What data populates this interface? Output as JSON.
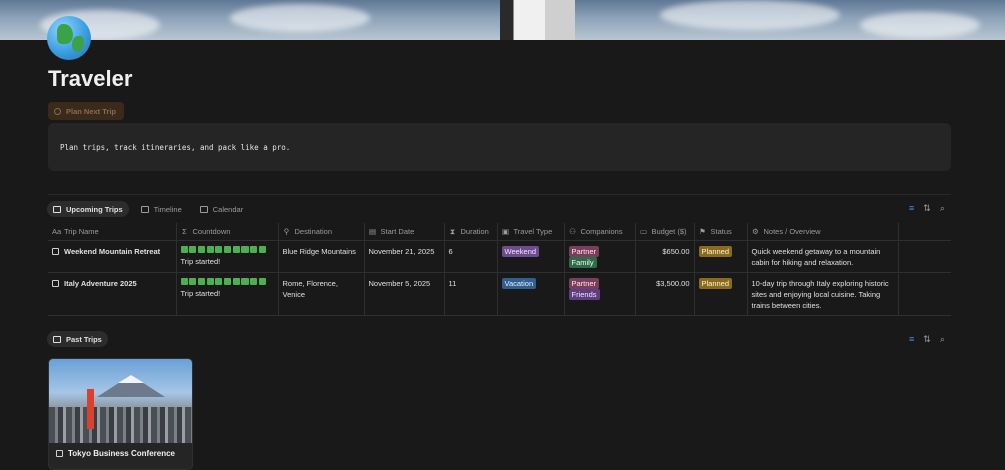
{
  "page": {
    "title": "Traveler",
    "button_label": "Plan Next Trip",
    "callout": "Plan trips, track itineraries, and pack like a pro."
  },
  "upcoming": {
    "views": [
      "Upcoming Trips",
      "Timeline",
      "Calendar"
    ],
    "columns": [
      "Trip Name",
      "Countdown",
      "Destination",
      "Start Date",
      "Duration",
      "Travel Type",
      "Companions",
      "Budget ($)",
      "Status",
      "Notes / Overview"
    ],
    "rows": [
      {
        "name": "Weekend Mountain Retreat",
        "countdown_progress": 1.0,
        "countdown_text": "Trip started!",
        "destination": "Blue Ridge Mountains",
        "start_date": "November 21, 2025",
        "duration": "6",
        "travel_type": "Weekend",
        "companions": [
          "Partner",
          "Family"
        ],
        "budget": "$650.00",
        "status": "Planned",
        "notes": "Quick weekend getaway to a mountain cabin for hiking and relaxation."
      },
      {
        "name": "Italy Adventure 2025",
        "countdown_progress": 1.0,
        "countdown_text": "Trip started!",
        "destination": "Rome, Florence, Venice",
        "start_date": "November 5, 2025",
        "duration": "11",
        "travel_type": "Vacation",
        "companions": [
          "Partner",
          "Friends"
        ],
        "budget": "$3,500.00",
        "status": "Planned",
        "notes": "10-day trip through Italy exploring historic sites and enjoying local cuisine. Taking trains between cities."
      }
    ]
  },
  "past": {
    "view": "Past Trips",
    "cards": [
      {
        "name": "Tokyo Business Conference"
      }
    ]
  },
  "colors": {
    "background": "#191919",
    "accent": "#4a90e2",
    "progress": "#4caf50"
  }
}
